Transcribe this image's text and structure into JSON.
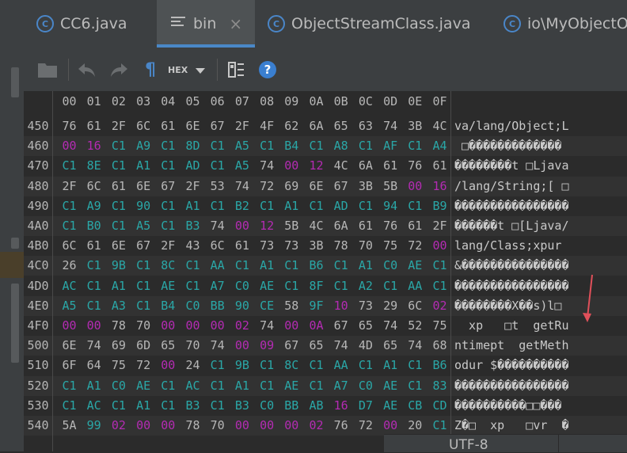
{
  "tabs": [
    {
      "label": "CC6.java",
      "icon": "class-icon",
      "active": false
    },
    {
      "label": "bin",
      "icon": "text-file-icon",
      "active": true,
      "close": "×"
    },
    {
      "label": "ObjectStreamClass.java",
      "icon": "class-icon",
      "active": false
    },
    {
      "label": "io\\MyObjectOu",
      "icon": "class-icon",
      "active": false
    }
  ],
  "toolbar": {
    "hex_label": "HEX",
    "pilcrow": "¶",
    "help": "?"
  },
  "hex": {
    "columns": [
      "00",
      "01",
      "02",
      "03",
      "04",
      "05",
      "06",
      "07",
      "08",
      "09",
      "0A",
      "0B",
      "0C",
      "0D",
      "0E",
      "0F"
    ],
    "rows": [
      {
        "addr": "450",
        "bytes": [
          "76",
          "61",
          "2F",
          "6C",
          "61",
          "6E",
          "67",
          "2F",
          "4F",
          "62",
          "6A",
          "65",
          "63",
          "74",
          "3B",
          "4C"
        ],
        "ascii": "va/lang/Object;L"
      },
      {
        "addr": "460",
        "bytes": [
          "00",
          "16",
          "C1",
          "A9",
          "C1",
          "8D",
          "C1",
          "A5",
          "C1",
          "B4",
          "C1",
          "A8",
          "C1",
          "AF",
          "C1",
          "A4"
        ],
        "ascii": " □�������������"
      },
      {
        "addr": "470",
        "bytes": [
          "C1",
          "8E",
          "C1",
          "A1",
          "C1",
          "AD",
          "C1",
          "A5",
          "74",
          "00",
          "12",
          "4C",
          "6A",
          "61",
          "76",
          "61"
        ],
        "ascii": "��������t □Ljava"
      },
      {
        "addr": "480",
        "bytes": [
          "2F",
          "6C",
          "61",
          "6E",
          "67",
          "2F",
          "53",
          "74",
          "72",
          "69",
          "6E",
          "67",
          "3B",
          "5B",
          "00",
          "16"
        ],
        "ascii": "/lang/String;[ □"
      },
      {
        "addr": "490",
        "bytes": [
          "C1",
          "A9",
          "C1",
          "90",
          "C1",
          "A1",
          "C1",
          "B2",
          "C1",
          "A1",
          "C1",
          "AD",
          "C1",
          "94",
          "C1",
          "B9"
        ],
        "ascii": "����������������"
      },
      {
        "addr": "4A0",
        "bytes": [
          "C1",
          "B0",
          "C1",
          "A5",
          "C1",
          "B3",
          "74",
          "00",
          "12",
          "5B",
          "4C",
          "6A",
          "61",
          "76",
          "61",
          "2F"
        ],
        "ascii": "������t □[Ljava/"
      },
      {
        "addr": "4B0",
        "bytes": [
          "6C",
          "61",
          "6E",
          "67",
          "2F",
          "43",
          "6C",
          "61",
          "73",
          "73",
          "3B",
          "78",
          "70",
          "75",
          "72",
          "00"
        ],
        "ascii": "lang/Class;xpur"
      },
      {
        "addr": "4C0",
        "bytes": [
          "26",
          "C1",
          "9B",
          "C1",
          "8C",
          "C1",
          "AA",
          "C1",
          "A1",
          "C1",
          "B6",
          "C1",
          "A1",
          "C0",
          "AE",
          "C1"
        ],
        "ascii": "&���������������"
      },
      {
        "addr": "4D0",
        "bytes": [
          "AC",
          "C1",
          "A1",
          "C1",
          "AE",
          "C1",
          "A7",
          "C0",
          "AE",
          "C1",
          "8F",
          "C1",
          "A2",
          "C1",
          "AA",
          "C1"
        ],
        "ascii": "����������������"
      },
      {
        "addr": "4E0",
        "bytes": [
          "A5",
          "C1",
          "A3",
          "C1",
          "B4",
          "C0",
          "BB",
          "90",
          "CE",
          "58",
          "9F",
          "10",
          "73",
          "29",
          "6C",
          "02"
        ],
        "ascii": "��������X��s)l□"
      },
      {
        "addr": "4F0",
        "bytes": [
          "00",
          "00",
          "78",
          "70",
          "00",
          "00",
          "00",
          "02",
          "74",
          "00",
          "0A",
          "67",
          "65",
          "74",
          "52",
          "75"
        ],
        "ascii": "  xp   □t  getRu"
      },
      {
        "addr": "500",
        "bytes": [
          "6E",
          "74",
          "69",
          "6D",
          "65",
          "70",
          "74",
          "00",
          "09",
          "67",
          "65",
          "74",
          "4D",
          "65",
          "74",
          "68"
        ],
        "ascii": "ntimept  getMeth"
      },
      {
        "addr": "510",
        "bytes": [
          "6F",
          "64",
          "75",
          "72",
          "00",
          "24",
          "C1",
          "9B",
          "C1",
          "8C",
          "C1",
          "AA",
          "C1",
          "A1",
          "C1",
          "B6"
        ],
        "ascii": "odur $����������"
      },
      {
        "addr": "520",
        "bytes": [
          "C1",
          "A1",
          "C0",
          "AE",
          "C1",
          "AC",
          "C1",
          "A1",
          "C1",
          "AE",
          "C1",
          "A7",
          "C0",
          "AE",
          "C1",
          "83"
        ],
        "ascii": "����������������"
      },
      {
        "addr": "530",
        "bytes": [
          "C1",
          "AC",
          "C1",
          "A1",
          "C1",
          "B3",
          "C1",
          "B3",
          "C0",
          "BB",
          "AB",
          "16",
          "D7",
          "AE",
          "CB",
          "CD"
        ],
        "ascii": "����������□□���"
      },
      {
        "addr": "540",
        "bytes": [
          "5A",
          "99",
          "02",
          "00",
          "00",
          "78",
          "70",
          "00",
          "00",
          "00",
          "02",
          "76",
          "72",
          "00",
          "20",
          "C1"
        ],
        "ascii": "Z�□  xp   □vr  �"
      }
    ]
  },
  "colors": {
    "normal": "#b7b7b7",
    "high": "#2aa7a7",
    "zero": "#b42bb3",
    "ascii": "#c9c9c9",
    "accent": "#4a88c7",
    "arrow": "#e0505a"
  },
  "status": {
    "encoding": "UTF-8"
  }
}
